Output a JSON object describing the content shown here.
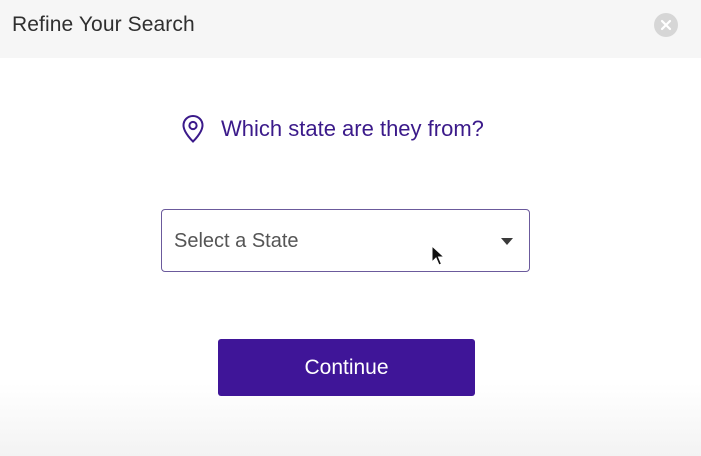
{
  "modal": {
    "title": "Refine Your Search",
    "close_icon": "close-icon"
  },
  "question": {
    "icon": "location-pin-icon",
    "text": "Which state are they from?"
  },
  "state_select": {
    "value": "Select a State",
    "icon": "caret-down-icon"
  },
  "continue_button": {
    "label": "Continue"
  },
  "colors": {
    "accent": "#3f1598",
    "question_text": "#3b1a8a",
    "header_bg": "#f6f6f6"
  }
}
